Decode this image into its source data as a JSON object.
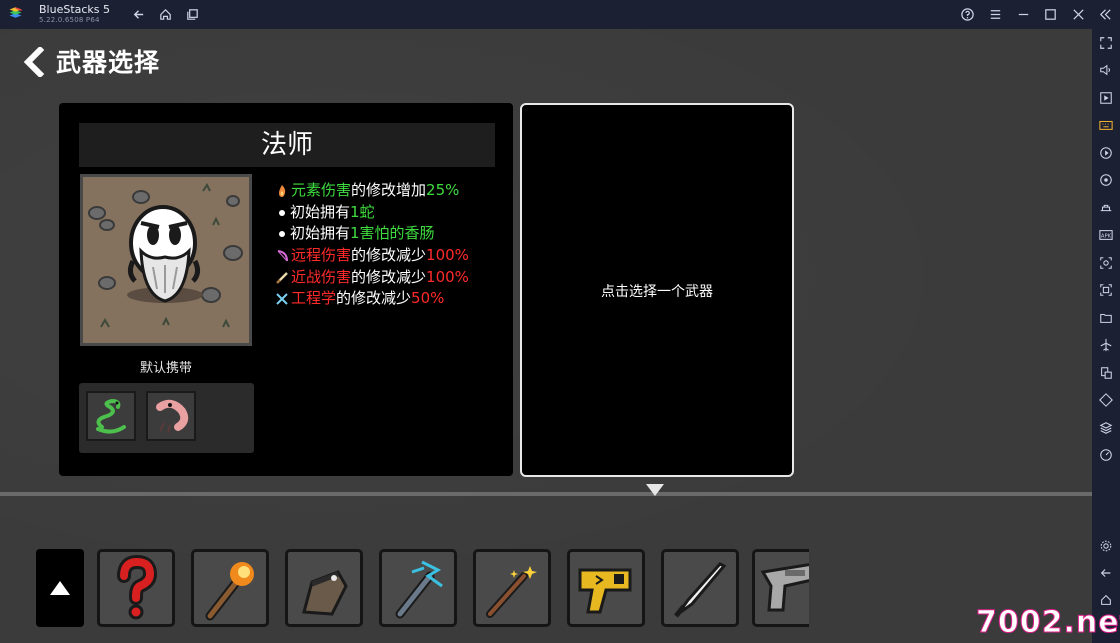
{
  "titlebar": {
    "app_name": "BlueStacks 5",
    "app_version": "5.22.0.6508  P64"
  },
  "game": {
    "screen_title": "武器选择",
    "character": {
      "name": "法师",
      "stats": [
        {
          "icon": "fire-icon",
          "segments": [
            {
              "text": "元素伤害",
              "color": "green"
            },
            {
              "text": "的修改增加",
              "color": "white"
            },
            {
              "text": "25%",
              "color": "green"
            }
          ]
        },
        {
          "icon": "bullet",
          "segments": [
            {
              "text": "初始拥有",
              "color": "white"
            },
            {
              "text": "1蛇",
              "color": "green"
            }
          ]
        },
        {
          "icon": "bullet",
          "segments": [
            {
              "text": "初始拥有",
              "color": "white"
            },
            {
              "text": "1害怕的香肠",
              "color": "green"
            }
          ]
        },
        {
          "icon": "bow-icon",
          "segments": [
            {
              "text": "远程伤害",
              "color": "red"
            },
            {
              "text": "的修改减少",
              "color": "white"
            },
            {
              "text": "100%",
              "color": "red"
            }
          ]
        },
        {
          "icon": "sword-icon",
          "segments": [
            {
              "text": "近战伤害",
              "color": "red"
            },
            {
              "text": "的修改减少",
              "color": "white"
            },
            {
              "text": "100%",
              "color": "red"
            }
          ]
        },
        {
          "icon": "wrench-icon",
          "segments": [
            {
              "text": "工程学",
              "color": "red"
            },
            {
              "text": "的修改减少",
              "color": "white"
            },
            {
              "text": "50%",
              "color": "red"
            }
          ]
        }
      ],
      "default_carry_label": "默认携带",
      "carry_items": [
        "snake-icon",
        "scared-sausage-icon"
      ]
    },
    "weapon_panel": {
      "hint": "点击选择一个武器"
    },
    "weapon_slots": [
      "random-question-icon",
      "torch-icon",
      "fist-icon",
      "lightning-staff-icon",
      "magic-wand-icon",
      "taser-icon",
      "sword-blade-icon",
      "gun-icon"
    ]
  },
  "watermark": "7002.net",
  "colors": {
    "green": "#3fdc3f",
    "red": "#ff2a2a",
    "panel": "#000000",
    "background": "#3b3b3b",
    "bluestacks_bar": "#1c2033"
  }
}
